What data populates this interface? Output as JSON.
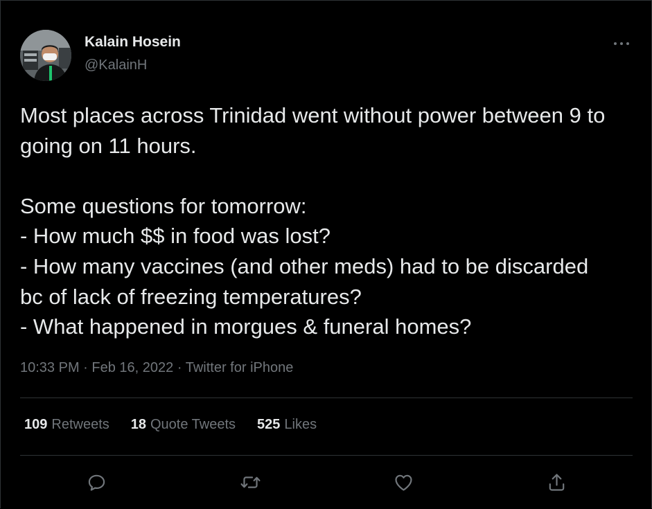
{
  "author": {
    "display_name": "Kalain Hosein",
    "handle": "@KalainH"
  },
  "tweet": {
    "text": "Most places across Trinidad went without power between 9 to going on 11 hours.\n\nSome questions for tomorrow:\n- How much $$ in food was lost?\n- How many vaccines (and other meds) had to be discarded bc of lack of freezing temperatures?\n- What happened in morgues & funeral homes?",
    "time": "10:33 PM",
    "date": "Feb 16, 2022",
    "source": "Twitter for iPhone",
    "separator": "·"
  },
  "stats": {
    "retweets_count": "109",
    "retweets_label": "Retweets",
    "quote_count": "18",
    "quote_label": "Quote Tweets",
    "likes_count": "525",
    "likes_label": "Likes"
  },
  "icons": {
    "more": "more-horizontal-icon",
    "reply": "reply-icon",
    "retweet": "retweet-icon",
    "like": "heart-icon",
    "share": "share-icon"
  },
  "colors": {
    "background": "#000000",
    "text_primary": "#e7e9ea",
    "text_secondary": "#71767b",
    "divider": "#2f3336"
  }
}
